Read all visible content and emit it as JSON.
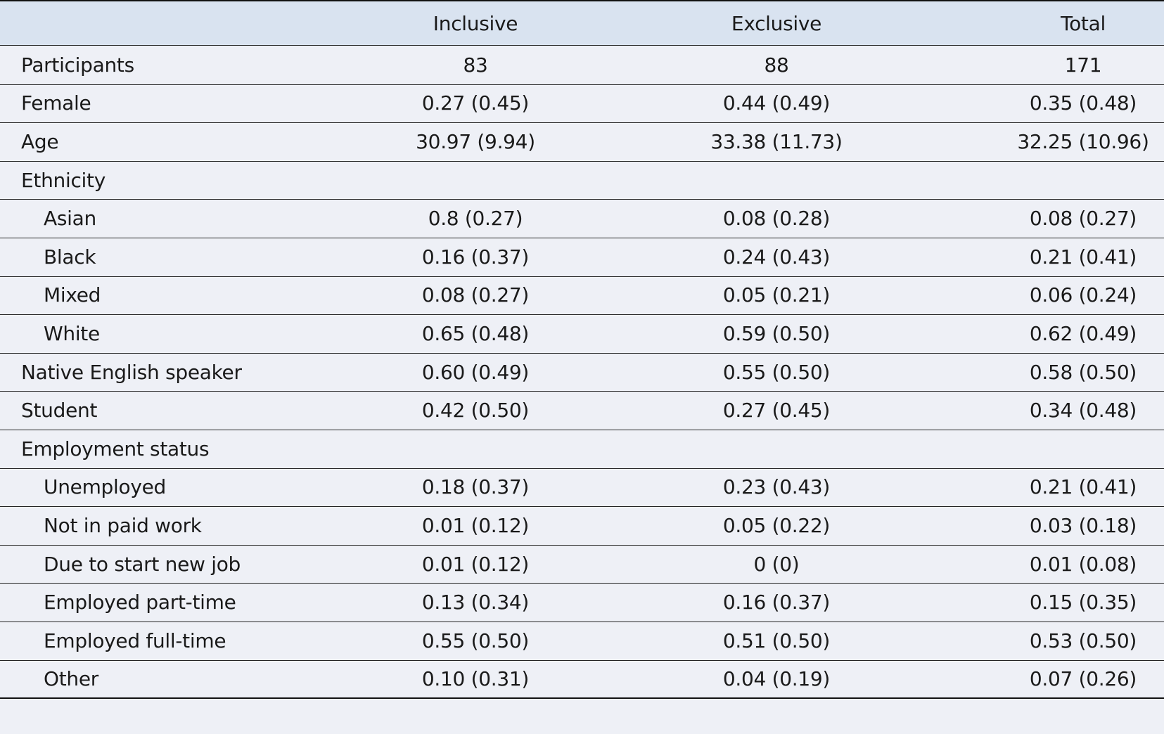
{
  "table": {
    "columns": [
      "",
      "Inclusive",
      "Exclusive",
      "Total"
    ],
    "rows": [
      {
        "label": "Participants",
        "indent": false,
        "inclusive": "83",
        "exclusive": "88",
        "total": "171"
      },
      {
        "label": "Female",
        "indent": false,
        "inclusive": "0.27 (0.45)",
        "exclusive": "0.44 (0.49)",
        "total": "0.35 (0.48)"
      },
      {
        "label": "Age",
        "indent": false,
        "inclusive": "30.97 (9.94)",
        "exclusive": "33.38 (11.73)",
        "total": "32.25 (10.96)"
      },
      {
        "label": "Ethnicity",
        "indent": false,
        "inclusive": "",
        "exclusive": "",
        "total": ""
      },
      {
        "label": "Asian",
        "indent": true,
        "inclusive": "0.8 (0.27)",
        "exclusive": "0.08 (0.28)",
        "total": "0.08 (0.27)"
      },
      {
        "label": "Black",
        "indent": true,
        "inclusive": "0.16 (0.37)",
        "exclusive": "0.24 (0.43)",
        "total": "0.21 (0.41)"
      },
      {
        "label": "Mixed",
        "indent": true,
        "inclusive": "0.08 (0.27)",
        "exclusive": "0.05 (0.21)",
        "total": "0.06 (0.24)"
      },
      {
        "label": "White",
        "indent": true,
        "inclusive": "0.65 (0.48)",
        "exclusive": "0.59 (0.50)",
        "total": "0.62 (0.49)"
      },
      {
        "label": "Native English speaker",
        "indent": false,
        "inclusive": "0.60 (0.49)",
        "exclusive": "0.55 (0.50)",
        "total": "0.58 (0.50)"
      },
      {
        "label": "Student",
        "indent": false,
        "inclusive": "0.42 (0.50)",
        "exclusive": "0.27 (0.45)",
        "total": "0.34 (0.48)"
      },
      {
        "label": "Employment status",
        "indent": false,
        "inclusive": "",
        "exclusive": "",
        "total": ""
      },
      {
        "label": "Unemployed",
        "indent": true,
        "inclusive": "0.18 (0.37)",
        "exclusive": "0.23 (0.43)",
        "total": "0.21 (0.41)"
      },
      {
        "label": "Not in paid work",
        "indent": true,
        "inclusive": "0.01 (0.12)",
        "exclusive": "0.05 (0.22)",
        "total": "0.03 (0.18)"
      },
      {
        "label": "Due to start new job",
        "indent": true,
        "inclusive": "0.01 (0.12)",
        "exclusive": "0 (0)",
        "total": "0.01 (0.08)"
      },
      {
        "label": "Employed part-time",
        "indent": true,
        "inclusive": "0.13 (0.34)",
        "exclusive": "0.16 (0.37)",
        "total": "0.15 (0.35)"
      },
      {
        "label": "Employed full-time",
        "indent": true,
        "inclusive": "0.55 (0.50)",
        "exclusive": "0.51 (0.50)",
        "total": "0.53 (0.50)"
      },
      {
        "label": "Other",
        "indent": true,
        "inclusive": "0.10 (0.31)",
        "exclusive": "0.04 (0.19)",
        "total": "0.07 (0.26)"
      }
    ]
  },
  "colors": {
    "header_background": "#d9e3f0",
    "body_background": "#eef0f6",
    "rule": "#222222"
  }
}
